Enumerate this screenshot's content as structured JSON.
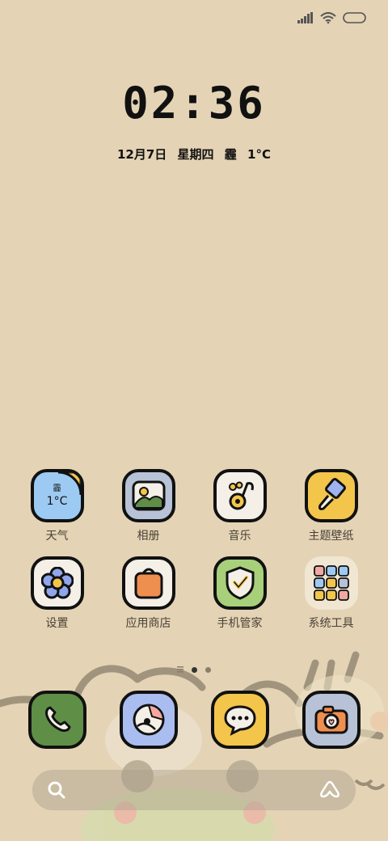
{
  "status": {
    "signal_icon": "signal-icon",
    "wifi_icon": "wifi-icon",
    "battery_icon": "battery-icon"
  },
  "clock": {
    "time": "02:36"
  },
  "date": {
    "date": "12月7日",
    "weekday": "星期四",
    "weather": "霾",
    "temperature": "1°C"
  },
  "apps": [
    {
      "label": "天气",
      "icon": "weather-icon",
      "weather_text": "霾",
      "temp": "1°C"
    },
    {
      "label": "相册",
      "icon": "gallery-icon"
    },
    {
      "label": "音乐",
      "icon": "music-icon"
    },
    {
      "label": "主题壁纸",
      "icon": "theme-brush-icon"
    },
    {
      "label": "设置",
      "icon": "flower-settings-icon"
    },
    {
      "label": "应用商店",
      "icon": "app-store-bag-icon"
    },
    {
      "label": "手机管家",
      "icon": "security-shield-icon"
    },
    {
      "label": "系统工具",
      "icon": "folder-icon"
    }
  ],
  "dock": [
    {
      "name": "phone",
      "icon": "phone-icon"
    },
    {
      "name": "browser",
      "icon": "browser-icon"
    },
    {
      "name": "messages",
      "icon": "message-icon"
    },
    {
      "name": "camera",
      "icon": "camera-icon"
    }
  ],
  "page_indicator": {
    "pages": 2,
    "current": 1
  },
  "search": {
    "search_icon": "search-icon",
    "assistant_icon": "assistant-icon"
  },
  "colors": {
    "background": "#e4d3b5",
    "weather_bg": "#9ccaf2",
    "gallery_bg": "#b8c2d6",
    "music_bg": "#f4efe7",
    "theme_bg": "#f3c54b",
    "settings_bg": "#f4efe7",
    "store_bg": "#f4efe7",
    "security_bg": "#a8d07a",
    "folder_bg": "#f1e6d2",
    "phone_bg": "#5f8f47",
    "browser_bg": "#aabdf0",
    "message_bg": "#f3c54b",
    "camera_bg": "#b8c2d6"
  }
}
